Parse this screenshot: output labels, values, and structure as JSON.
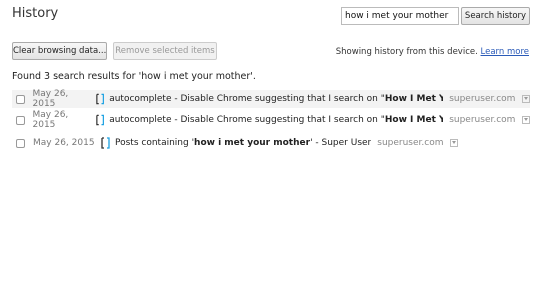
{
  "header": {
    "title": "History",
    "search_value": "how i met your mother",
    "search_button": "Search history"
  },
  "toolbar": {
    "clear_label": "Clear browsing data...",
    "remove_label": "Remove selected items"
  },
  "info": {
    "text": "Showing history from this device.",
    "link": "Learn more"
  },
  "results_summary": "Found 3 search results for 'how i met your mother'.",
  "results": [
    {
      "date": "May 26, 2015",
      "prefix": "autocomplete - Disable Chrome suggesting that I search on \"",
      "bold": "How I Met Your Mothe…",
      "suffix": "",
      "domain": "superuser.com"
    },
    {
      "date": "May 26, 2015",
      "prefix": "autocomplete - Disable Chrome suggesting that I search on \"",
      "bold": "How I Met Your Mothe…",
      "suffix": "",
      "domain": "superuser.com"
    },
    {
      "date": "May 26, 2015",
      "prefix": "Posts containing '",
      "bold": "how i met your mother",
      "suffix": "' - Super User",
      "domain": "superuser.com"
    }
  ]
}
